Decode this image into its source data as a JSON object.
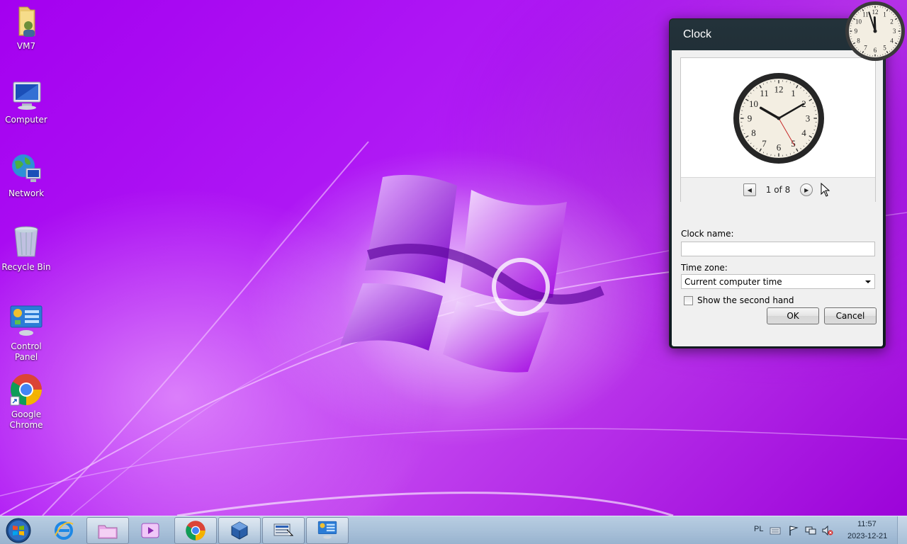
{
  "desktop": {
    "icons": [
      {
        "label": "VM7"
      },
      {
        "label": "Computer"
      },
      {
        "label": "Network"
      },
      {
        "label": "Recycle Bin"
      },
      {
        "label": "Control Panel"
      },
      {
        "label": "Google Chrome"
      }
    ]
  },
  "clock_dialog": {
    "title": "Clock",
    "preview_pager": "1 of 8",
    "clock_name_label": "Clock name:",
    "clock_name_value": "",
    "time_zone_label": "Time zone:",
    "time_zone_value": "Current computer time",
    "second_hand_label": "Show the second hand",
    "second_hand_checked": false,
    "ok_label": "OK",
    "cancel_label": "Cancel",
    "preview_clock_numbers": [
      "12",
      "1",
      "2",
      "3",
      "4",
      "5",
      "6",
      "7",
      "8",
      "9",
      "10",
      "11"
    ]
  },
  "gadget_clock": {
    "numbers": [
      "12",
      "1",
      "2",
      "3",
      "4",
      "5",
      "6",
      "7",
      "8",
      "9",
      "10",
      "11"
    ]
  },
  "taskbar": {
    "items": [
      "internet-explorer",
      "windows-explorer",
      "media-player",
      "google-chrome",
      "virtualbox",
      "on-screen-keyboard",
      "control-panel"
    ],
    "tray": {
      "language": "PL",
      "time": "11:57",
      "date": "2023-12-21"
    }
  }
}
